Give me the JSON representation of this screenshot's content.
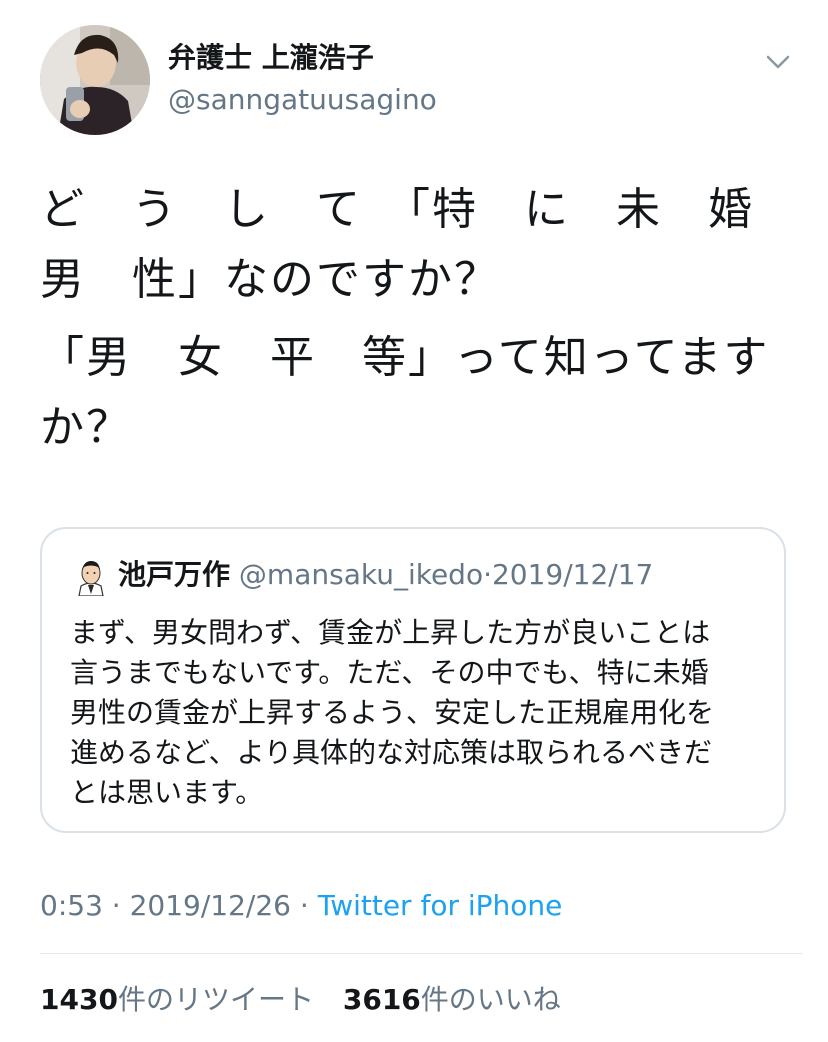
{
  "author": {
    "display_name": "弁護士 上瀧浩子",
    "handle": "@sanngatuusagino"
  },
  "icons": {
    "menu": "chevron-down-icon",
    "avatar": "user-avatar",
    "quote_avatar": "quoted-user-avatar"
  },
  "tweet": {
    "lines": [
      "ど　う　し　て　「特　に　未　婚\n男　性」なのですか？",
      "「男　女　平　等」って知ってます\nか？"
    ]
  },
  "quote": {
    "name": "池戸万作",
    "handle": "@mansaku_ikedo",
    "separator": "·",
    "date": "2019/12/17",
    "body": "まず、男女問わず、賃金が上昇した方が良いことは\n言うまでもないです。ただ、その中でも、特に未婚\n男性の賃金が上昇するよう、安定した正規雇用化を\n進めるなど、より具体的な対応策は取られるべきだ\nとは思います。"
  },
  "meta": {
    "time": "0:53",
    "separator1": "·",
    "date": "2019/12/26",
    "separator2": "·",
    "source": "Twitter for iPhone"
  },
  "stats": {
    "retweets_count": "1430",
    "retweets_label": "件のリツイート",
    "likes_count": "3616",
    "likes_label": "件のいいね"
  },
  "colors": {
    "link": "#1da1f2",
    "secondary": "#657786",
    "text": "#14171a",
    "border": "#d9e0e6"
  }
}
